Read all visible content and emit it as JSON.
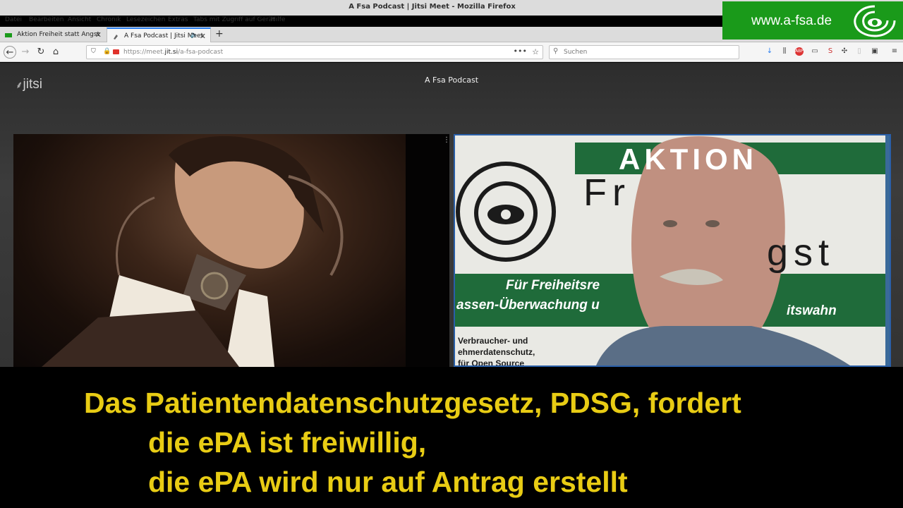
{
  "window": {
    "title": "A Fsa Podcast | Jitsi Meet - Mozilla Firefox"
  },
  "menu": [
    "Datei",
    "Bearbeiten",
    "Ansicht",
    "Chronik",
    "Lesezeichen",
    "Extras",
    "Tabs mit Zugriff auf Gerät",
    "Hilfe"
  ],
  "tabs": [
    {
      "label": "Aktion Freiheit statt Angst"
    },
    {
      "label": "A Fsa Podcast | Jitsi Meet"
    }
  ],
  "addressbar": {
    "url_prefix": "https://meet.",
    "url_domain": "jit.si",
    "url_path": "/a-fsa-podcast"
  },
  "searchbar": {
    "placeholder": "Suchen"
  },
  "brand": {
    "url": "www.a-fsa.de",
    "color": "#1a9a1a"
  },
  "meeting": {
    "logo": "jitsi",
    "title": "A Fsa Podcast"
  },
  "banner_text": {
    "line1": "Für Freiheitsre",
    "line2": "assen-Überwachung u",
    "line3": "itswahn",
    "big1": "AKTION",
    "big2": "Fr",
    "big3": "gst",
    "small1": "Verbraucher- und",
    "small2": "ehmerdatenschutz,",
    "small3": "für Open Source"
  },
  "subtitles": {
    "line1": "Das Patientendatenschutzgesetz, PDSG, fordert",
    "line2": "die ePA ist freiwillig,",
    "line3": "die ePA wird nur auf Antrag erstellt",
    "color": "#e8cc14"
  }
}
